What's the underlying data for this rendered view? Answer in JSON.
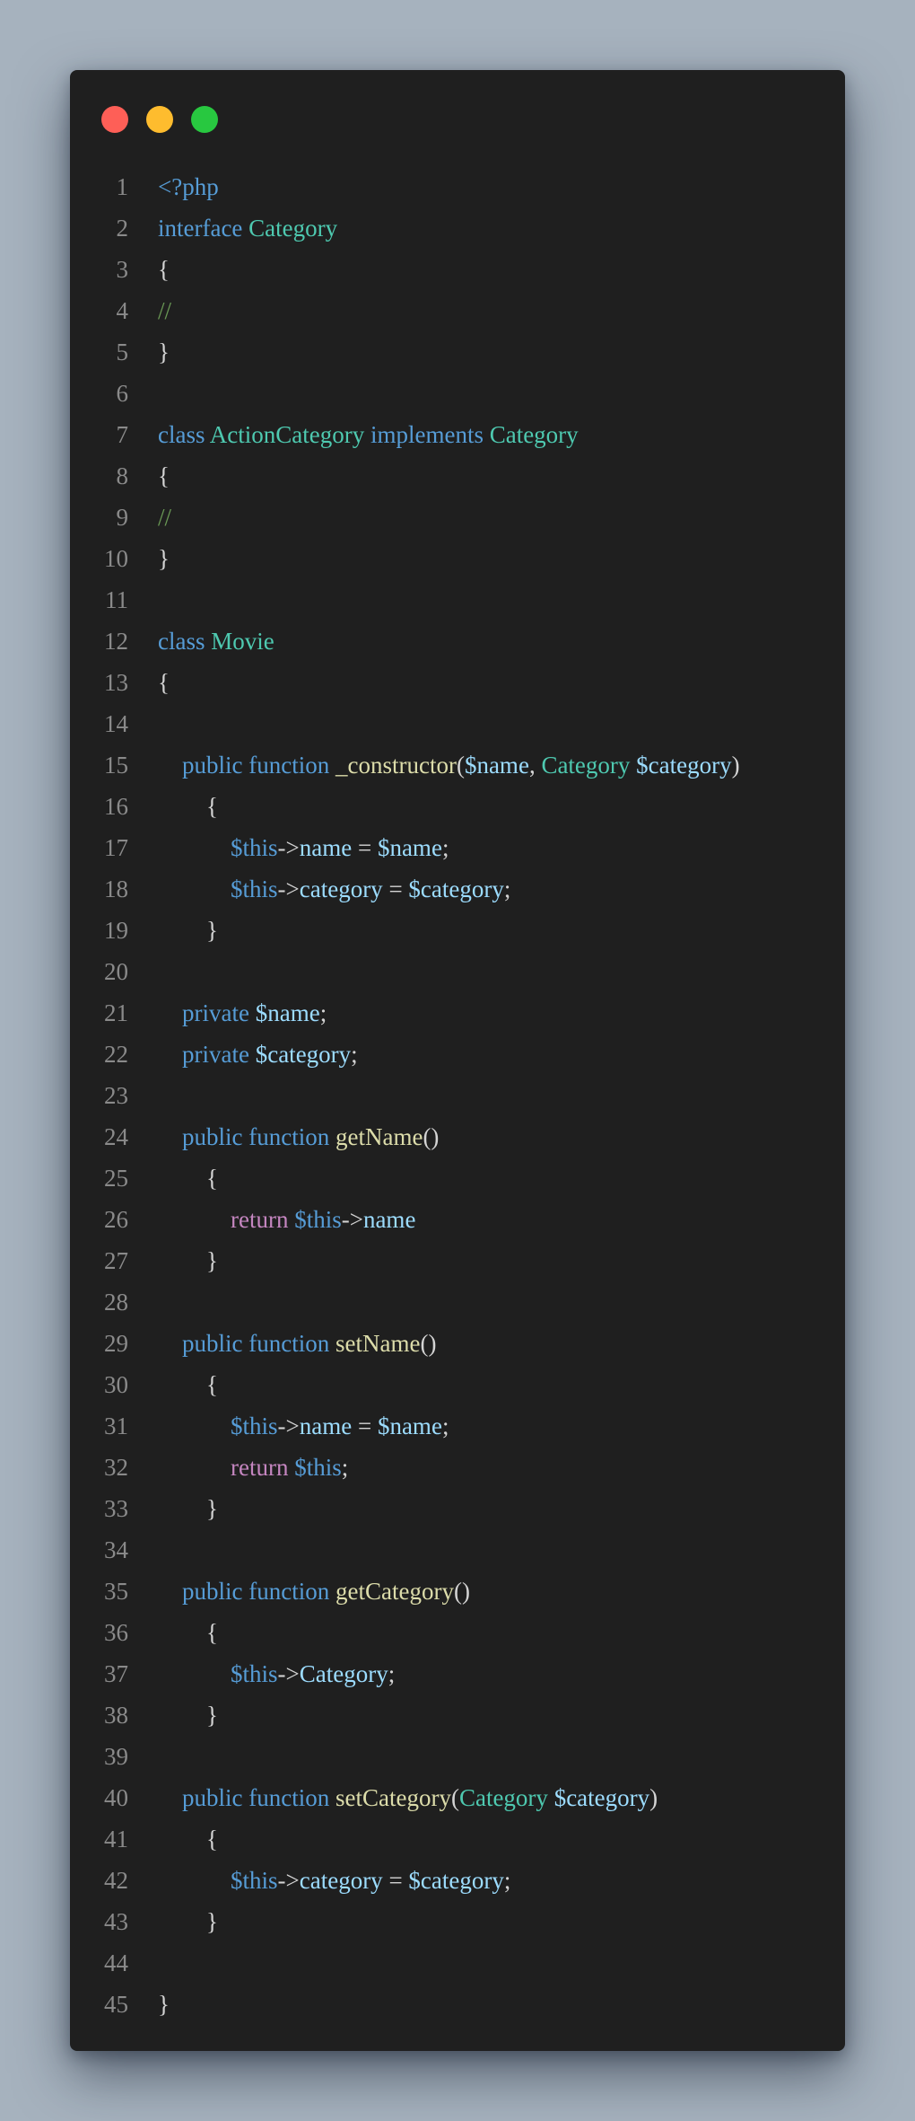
{
  "window": {
    "controls": [
      "close",
      "minimize",
      "maximize"
    ],
    "colors": {
      "background": "#1f1f1f",
      "page_background": "#a6b2be",
      "close": "#fe5f57",
      "minimize": "#febc2e",
      "maximize": "#28c840"
    }
  },
  "syntax_colors": {
    "kw": "#569cd6",
    "type": "#4ec9b0",
    "var": "#9cdcfe",
    "this": "#569cd6",
    "fn": "#dcdcaa",
    "ctrl": "#c586c0",
    "cmt": "#6a9955",
    "punc": "#d4d4d4",
    "line_number": "#8a8a8a"
  },
  "editor": {
    "lines": [
      {
        "n": "1",
        "tokens": [
          {
            "t": "<?php",
            "c": "kw"
          }
        ]
      },
      {
        "n": "2",
        "tokens": [
          {
            "t": "interface",
            "c": "kw"
          },
          {
            "t": " ",
            "c": "punc"
          },
          {
            "t": "Category",
            "c": "type"
          }
        ]
      },
      {
        "n": "3",
        "tokens": [
          {
            "t": "{",
            "c": "punc"
          }
        ]
      },
      {
        "n": "4",
        "tokens": [
          {
            "t": "//",
            "c": "cmt"
          }
        ]
      },
      {
        "n": "5",
        "tokens": [
          {
            "t": "}",
            "c": "punc"
          }
        ]
      },
      {
        "n": "6",
        "tokens": []
      },
      {
        "n": "7",
        "tokens": [
          {
            "t": "class",
            "c": "kw"
          },
          {
            "t": " ",
            "c": "punc"
          },
          {
            "t": "ActionCategory",
            "c": "type"
          },
          {
            "t": " ",
            "c": "punc"
          },
          {
            "t": "implements",
            "c": "kw"
          },
          {
            "t": " ",
            "c": "punc"
          },
          {
            "t": "Category",
            "c": "type"
          }
        ]
      },
      {
        "n": "8",
        "tokens": [
          {
            "t": "{",
            "c": "punc"
          }
        ]
      },
      {
        "n": "9",
        "tokens": [
          {
            "t": "//",
            "c": "cmt"
          }
        ]
      },
      {
        "n": "10",
        "tokens": [
          {
            "t": "}",
            "c": "punc"
          }
        ]
      },
      {
        "n": "11",
        "tokens": []
      },
      {
        "n": "12",
        "tokens": [
          {
            "t": "class",
            "c": "kw"
          },
          {
            "t": " ",
            "c": "punc"
          },
          {
            "t": "Movie",
            "c": "type"
          }
        ]
      },
      {
        "n": "13",
        "tokens": [
          {
            "t": "{",
            "c": "punc"
          }
        ]
      },
      {
        "n": "14",
        "tokens": []
      },
      {
        "n": "15",
        "tokens": [
          {
            "t": "    ",
            "c": "punc"
          },
          {
            "t": "public",
            "c": "kw"
          },
          {
            "t": " ",
            "c": "punc"
          },
          {
            "t": "function",
            "c": "kw"
          },
          {
            "t": " ",
            "c": "punc"
          },
          {
            "t": "_constructor",
            "c": "fn"
          },
          {
            "t": "(",
            "c": "punc"
          },
          {
            "t": "$name",
            "c": "var"
          },
          {
            "t": ", ",
            "c": "punc"
          },
          {
            "t": "Category",
            "c": "type"
          },
          {
            "t": " ",
            "c": "punc"
          },
          {
            "t": "$category",
            "c": "var"
          },
          {
            "t": ")",
            "c": "punc"
          }
        ]
      },
      {
        "n": "16",
        "tokens": [
          {
            "t": "        ",
            "c": "punc"
          },
          {
            "t": "{",
            "c": "punc"
          }
        ]
      },
      {
        "n": "17",
        "tokens": [
          {
            "t": "            ",
            "c": "punc"
          },
          {
            "t": "$this",
            "c": "this"
          },
          {
            "t": "->",
            "c": "punc"
          },
          {
            "t": "name",
            "c": "var"
          },
          {
            "t": " = ",
            "c": "punc"
          },
          {
            "t": "$name",
            "c": "var"
          },
          {
            "t": ";",
            "c": "punc"
          }
        ]
      },
      {
        "n": "18",
        "tokens": [
          {
            "t": "            ",
            "c": "punc"
          },
          {
            "t": "$this",
            "c": "this"
          },
          {
            "t": "->",
            "c": "punc"
          },
          {
            "t": "category",
            "c": "var"
          },
          {
            "t": " = ",
            "c": "punc"
          },
          {
            "t": "$category",
            "c": "var"
          },
          {
            "t": ";",
            "c": "punc"
          }
        ]
      },
      {
        "n": "19",
        "tokens": [
          {
            "t": "        ",
            "c": "punc"
          },
          {
            "t": "}",
            "c": "punc"
          }
        ]
      },
      {
        "n": "20",
        "tokens": []
      },
      {
        "n": "21",
        "tokens": [
          {
            "t": "    ",
            "c": "punc"
          },
          {
            "t": "private",
            "c": "kw"
          },
          {
            "t": " ",
            "c": "punc"
          },
          {
            "t": "$name",
            "c": "var"
          },
          {
            "t": ";",
            "c": "punc"
          }
        ]
      },
      {
        "n": "22",
        "tokens": [
          {
            "t": "    ",
            "c": "punc"
          },
          {
            "t": "private",
            "c": "kw"
          },
          {
            "t": " ",
            "c": "punc"
          },
          {
            "t": "$category",
            "c": "var"
          },
          {
            "t": ";",
            "c": "punc"
          }
        ]
      },
      {
        "n": "23",
        "tokens": []
      },
      {
        "n": "24",
        "tokens": [
          {
            "t": "    ",
            "c": "punc"
          },
          {
            "t": "public",
            "c": "kw"
          },
          {
            "t": " ",
            "c": "punc"
          },
          {
            "t": "function",
            "c": "kw"
          },
          {
            "t": " ",
            "c": "punc"
          },
          {
            "t": "getName",
            "c": "fn"
          },
          {
            "t": "()",
            "c": "punc"
          }
        ]
      },
      {
        "n": "25",
        "tokens": [
          {
            "t": "        ",
            "c": "punc"
          },
          {
            "t": "{",
            "c": "punc"
          }
        ]
      },
      {
        "n": "26",
        "tokens": [
          {
            "t": "            ",
            "c": "punc"
          },
          {
            "t": "return",
            "c": "ctrl"
          },
          {
            "t": " ",
            "c": "punc"
          },
          {
            "t": "$this",
            "c": "this"
          },
          {
            "t": "->",
            "c": "punc"
          },
          {
            "t": "name",
            "c": "var"
          }
        ]
      },
      {
        "n": "27",
        "tokens": [
          {
            "t": "        ",
            "c": "punc"
          },
          {
            "t": "}",
            "c": "punc"
          }
        ]
      },
      {
        "n": "28",
        "tokens": []
      },
      {
        "n": "29",
        "tokens": [
          {
            "t": "    ",
            "c": "punc"
          },
          {
            "t": "public",
            "c": "kw"
          },
          {
            "t": " ",
            "c": "punc"
          },
          {
            "t": "function",
            "c": "kw"
          },
          {
            "t": " ",
            "c": "punc"
          },
          {
            "t": "setName",
            "c": "fn"
          },
          {
            "t": "()",
            "c": "punc"
          }
        ]
      },
      {
        "n": "30",
        "tokens": [
          {
            "t": "        ",
            "c": "punc"
          },
          {
            "t": "{",
            "c": "punc"
          }
        ]
      },
      {
        "n": "31",
        "tokens": [
          {
            "t": "            ",
            "c": "punc"
          },
          {
            "t": "$this",
            "c": "this"
          },
          {
            "t": "->",
            "c": "punc"
          },
          {
            "t": "name",
            "c": "var"
          },
          {
            "t": " = ",
            "c": "punc"
          },
          {
            "t": "$name",
            "c": "var"
          },
          {
            "t": ";",
            "c": "punc"
          }
        ]
      },
      {
        "n": "32",
        "tokens": [
          {
            "t": "            ",
            "c": "punc"
          },
          {
            "t": "return",
            "c": "ctrl"
          },
          {
            "t": " ",
            "c": "punc"
          },
          {
            "t": "$this",
            "c": "this"
          },
          {
            "t": ";",
            "c": "punc"
          }
        ]
      },
      {
        "n": "33",
        "tokens": [
          {
            "t": "        ",
            "c": "punc"
          },
          {
            "t": "}",
            "c": "punc"
          }
        ]
      },
      {
        "n": "34",
        "tokens": []
      },
      {
        "n": "35",
        "tokens": [
          {
            "t": "    ",
            "c": "punc"
          },
          {
            "t": "public",
            "c": "kw"
          },
          {
            "t": " ",
            "c": "punc"
          },
          {
            "t": "function",
            "c": "kw"
          },
          {
            "t": " ",
            "c": "punc"
          },
          {
            "t": "getCategory",
            "c": "fn"
          },
          {
            "t": "()",
            "c": "punc"
          }
        ]
      },
      {
        "n": "36",
        "tokens": [
          {
            "t": "        ",
            "c": "punc"
          },
          {
            "t": "{",
            "c": "punc"
          }
        ]
      },
      {
        "n": "37",
        "tokens": [
          {
            "t": "            ",
            "c": "punc"
          },
          {
            "t": "$this",
            "c": "this"
          },
          {
            "t": "->",
            "c": "punc"
          },
          {
            "t": "Category",
            "c": "var"
          },
          {
            "t": ";",
            "c": "punc"
          }
        ]
      },
      {
        "n": "38",
        "tokens": [
          {
            "t": "        ",
            "c": "punc"
          },
          {
            "t": "}",
            "c": "punc"
          }
        ]
      },
      {
        "n": "39",
        "tokens": []
      },
      {
        "n": "40",
        "tokens": [
          {
            "t": "    ",
            "c": "punc"
          },
          {
            "t": "public",
            "c": "kw"
          },
          {
            "t": " ",
            "c": "punc"
          },
          {
            "t": "function",
            "c": "kw"
          },
          {
            "t": " ",
            "c": "punc"
          },
          {
            "t": "setCategory",
            "c": "fn"
          },
          {
            "t": "(",
            "c": "punc"
          },
          {
            "t": "Category",
            "c": "type"
          },
          {
            "t": " ",
            "c": "punc"
          },
          {
            "t": "$category",
            "c": "var"
          },
          {
            "t": ")",
            "c": "punc"
          }
        ]
      },
      {
        "n": "41",
        "tokens": [
          {
            "t": "        ",
            "c": "punc"
          },
          {
            "t": "{",
            "c": "punc"
          }
        ]
      },
      {
        "n": "42",
        "tokens": [
          {
            "t": "            ",
            "c": "punc"
          },
          {
            "t": "$this",
            "c": "this"
          },
          {
            "t": "->",
            "c": "punc"
          },
          {
            "t": "category",
            "c": "var"
          },
          {
            "t": " = ",
            "c": "punc"
          },
          {
            "t": "$category",
            "c": "var"
          },
          {
            "t": ";",
            "c": "punc"
          }
        ]
      },
      {
        "n": "43",
        "tokens": [
          {
            "t": "        ",
            "c": "punc"
          },
          {
            "t": "}",
            "c": "punc"
          }
        ]
      },
      {
        "n": "44",
        "tokens": []
      },
      {
        "n": "45",
        "tokens": [
          {
            "t": "}",
            "c": "punc"
          }
        ]
      }
    ]
  }
}
